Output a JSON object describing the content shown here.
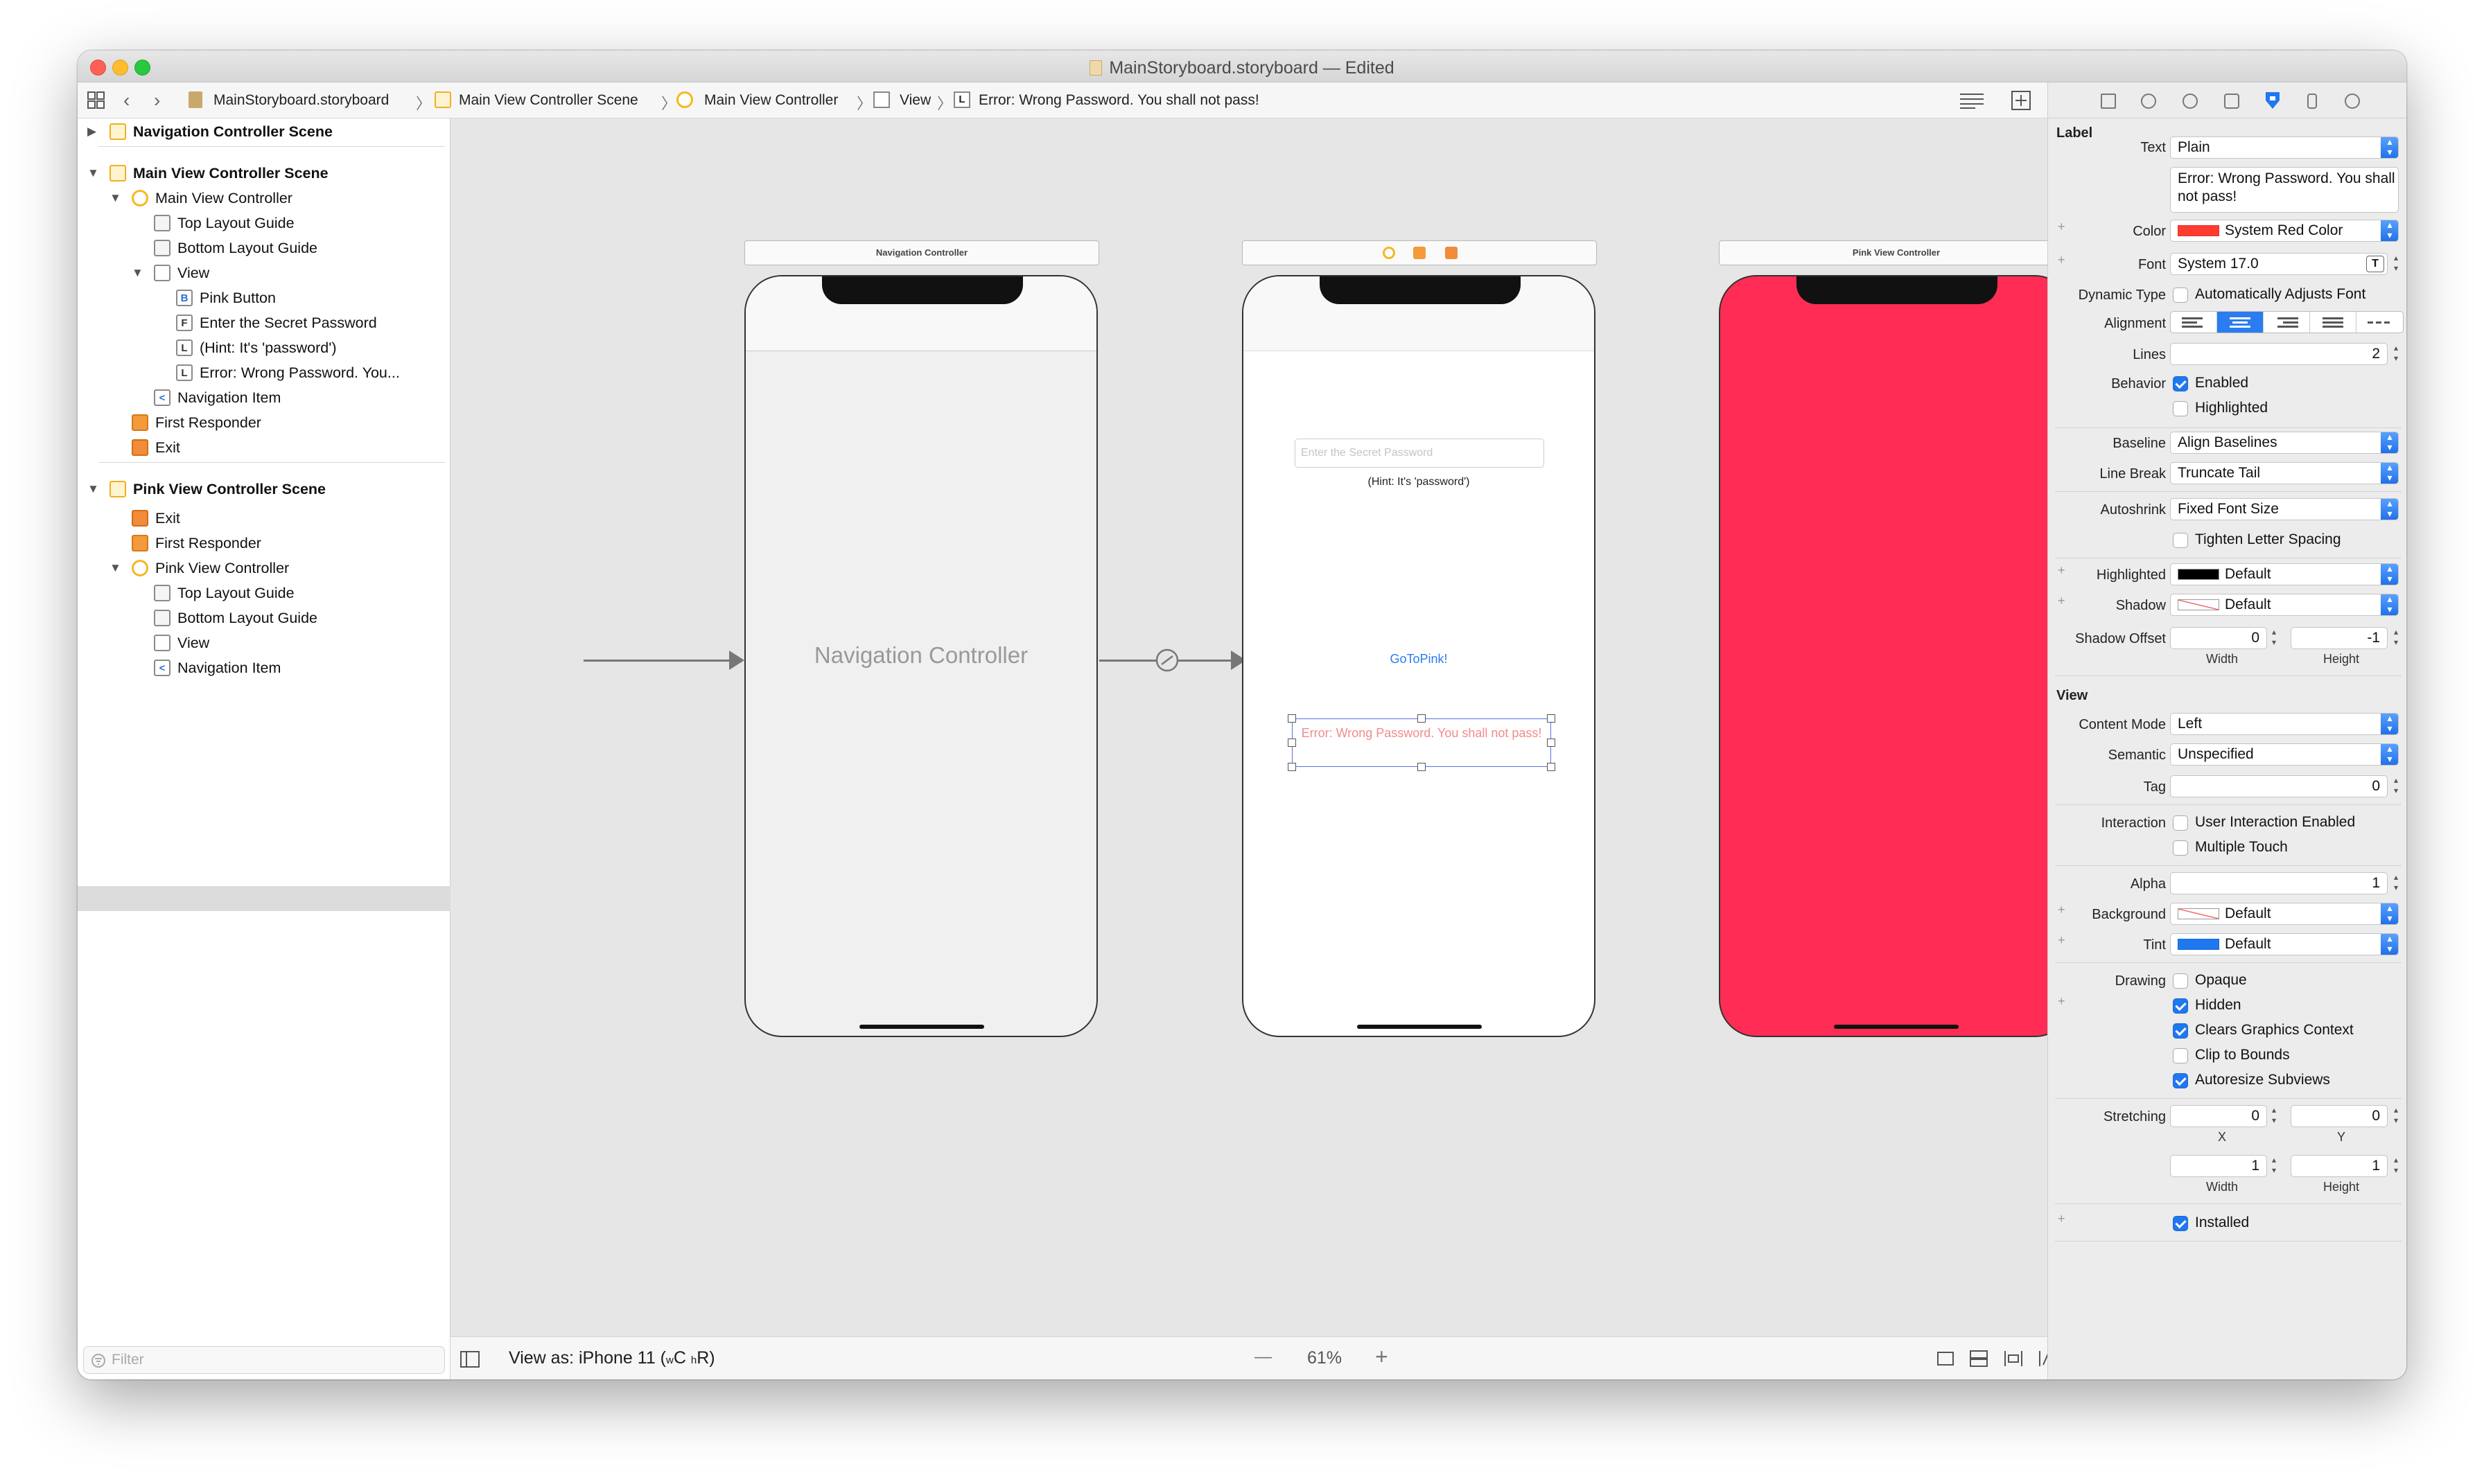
{
  "window": {
    "title": "MainStoryboard.storyboard — Edited"
  },
  "breadcrumb": {
    "items": [
      "MainStoryboard.storyboard",
      "Main View Controller Scene",
      "Main View Controller",
      "View",
      "Error: Wrong Password. You shall not pass!"
    ]
  },
  "navigator": {
    "rows": [
      {
        "label": "Navigation Controller Scene",
        "icon": "scene"
      },
      {
        "label": "Main View Controller Scene",
        "icon": "scene"
      },
      {
        "label": "Main View Controller",
        "icon": "vc"
      },
      {
        "label": "Top Layout Guide",
        "icon": "guide"
      },
      {
        "label": "Bottom Layout Guide",
        "icon": "guide"
      },
      {
        "label": "View",
        "icon": "view"
      },
      {
        "label": "Pink Button",
        "icon": "B"
      },
      {
        "label": "Enter the Secret Password",
        "icon": "F"
      },
      {
        "label": "(Hint: It's 'password')",
        "icon": "L"
      },
      {
        "label": "Error: Wrong Password. You...",
        "icon": "L"
      },
      {
        "label": "Navigation Item",
        "icon": "<"
      },
      {
        "label": "First Responder",
        "icon": "fr"
      },
      {
        "label": "Exit",
        "icon": "exit"
      },
      {
        "label": "Pink View Controller Scene",
        "icon": "scene"
      },
      {
        "label": "Exit",
        "icon": "exit"
      },
      {
        "label": "First Responder",
        "icon": "fr"
      },
      {
        "label": "Pink View Controller",
        "icon": "vc"
      },
      {
        "label": "Top Layout Guide",
        "icon": "guide"
      },
      {
        "label": "Bottom Layout Guide",
        "icon": "guide"
      },
      {
        "label": "View",
        "icon": "view"
      },
      {
        "label": "Navigation Item",
        "icon": "<"
      }
    ],
    "icon_letters": {
      "button": "B",
      "textfield": "F",
      "label": "L",
      "navitem": "<"
    },
    "filter_placeholder": "Filter"
  },
  "canvas": {
    "nav_scene_title": "Navigation Controller",
    "nav_center_label": "Navigation Controller",
    "main_password_placeholder": "Enter the Secret Password",
    "main_hint": "(Hint: It's 'password')",
    "main_button": "GoToPink!",
    "main_error": "Error: Wrong Password. You shall not pass!",
    "pink_scene_title": "Pink View Controller",
    "pink_color": "#ff2d55",
    "error_color": "#f28b8b",
    "button_color": "#2a7cf0"
  },
  "bottombar": {
    "view_as": "View as: iPhone 11 (",
    "view_as_w": "w",
    "view_as_c": "C ",
    "view_as_h": "h",
    "view_as_r": "R)",
    "zoom": "61%",
    "minus": "—",
    "plus": "+"
  },
  "inspector": {
    "label_section": "Label",
    "text_label": "Text",
    "text_value": "Plain",
    "text_content": "Error: Wrong Password. You shall not pass!",
    "color_label": "Color",
    "color_value": "System Red Color",
    "font_label": "Font",
    "font_value": "System 17.0",
    "dynamic_label": "Dynamic Type",
    "dynamic_value": "Automatically Adjusts Font",
    "alignment_label": "Alignment",
    "lines_label": "Lines",
    "lines_value": "2",
    "behavior_label": "Behavior",
    "enabled": "Enabled",
    "highlighted": "Highlighted",
    "baseline_label": "Baseline",
    "baseline_value": "Align Baselines",
    "linebreak_label": "Line Break",
    "linebreak_value": "Truncate Tail",
    "autoshrink_label": "Autoshrink",
    "autoshrink_value": "Fixed Font Size",
    "tighten": "Tighten Letter Spacing",
    "highlighted_label": "Highlighted",
    "highlighted_value": "Default",
    "shadow_label": "Shadow",
    "shadow_value": "Default",
    "shadowoffset_label": "Shadow Offset",
    "shadow_w": "0",
    "shadow_h": "-1",
    "width": "Width",
    "height": "Height",
    "view_section": "View",
    "contentmode_label": "Content Mode",
    "contentmode_value": "Left",
    "semantic_label": "Semantic",
    "semantic_value": "Unspecified",
    "tag_label": "Tag",
    "tag_value": "0",
    "interaction_label": "Interaction",
    "user_interaction": "User Interaction Enabled",
    "multiple_touch": "Multiple Touch",
    "alpha_label": "Alpha",
    "alpha_value": "1",
    "background_label": "Background",
    "background_value": "Default",
    "tint_label": "Tint",
    "tint_value": "Default",
    "drawing_label": "Drawing",
    "opaque": "Opaque",
    "hidden": "Hidden",
    "clears": "Clears Graphics Context",
    "clip": "Clip to Bounds",
    "autoresize": "Autoresize Subviews",
    "stretching_label": "Stretching",
    "str_x": "0",
    "str_y": "0",
    "x": "X",
    "y": "Y",
    "str_w": "1",
    "str_h": "1",
    "installed": "Installed",
    "system_red": "#ff3b30",
    "tint_blue": "#1f78f0"
  }
}
